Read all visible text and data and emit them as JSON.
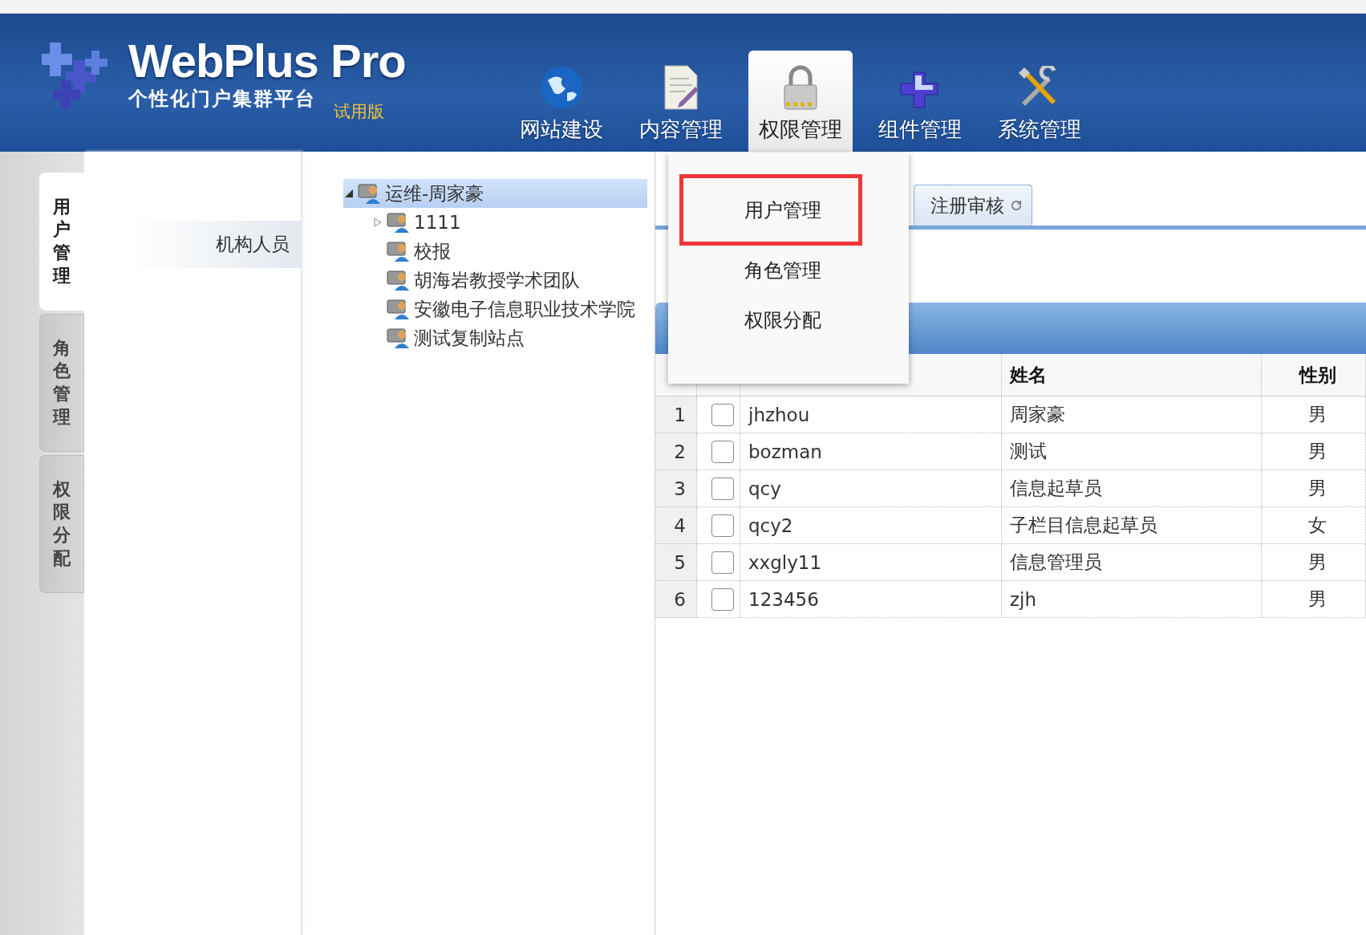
{
  "header": {
    "logo_title": "WebPlus Pro",
    "logo_subtitle": "个性化门户集群平台",
    "edition": "试用版",
    "nav": [
      {
        "label": "网站建设",
        "kind": "globe",
        "selected": false
      },
      {
        "label": "内容管理",
        "kind": "document",
        "selected": false
      },
      {
        "label": "权限管理",
        "kind": "lock",
        "selected": true
      },
      {
        "label": "组件管理",
        "kind": "puzzle",
        "selected": false
      },
      {
        "label": "系统管理",
        "kind": "tools",
        "selected": false
      }
    ]
  },
  "side_tabs": [
    {
      "label": "用户管理",
      "selected": true
    },
    {
      "label": "角色管理",
      "selected": false
    },
    {
      "label": "权限分配",
      "selected": false
    }
  ],
  "left_menu": [
    {
      "label": "机构人员",
      "selected": true
    }
  ],
  "tree": {
    "label": "运维-周家豪",
    "selected": true,
    "expanded": true,
    "children": [
      {
        "label": "1111",
        "kind": "branch",
        "selected": false
      },
      {
        "label": "校报",
        "kind": "leaf",
        "selected": false
      },
      {
        "label": "胡海岩教授学术团队",
        "kind": "leaf",
        "selected": false
      },
      {
        "label": "安徽电子信息职业技术学院",
        "kind": "leaf",
        "selected": false
      },
      {
        "label": "测试复制站点",
        "kind": "leaf",
        "selected": false
      }
    ]
  },
  "tabs": [
    {
      "label": "注册审核",
      "selected": false
    }
  ],
  "table": {
    "columns": [
      {
        "label": "姓名"
      },
      {
        "label": "性别"
      }
    ],
    "rows": [
      {
        "number": "1",
        "checked": false,
        "login": "jhzhou",
        "name": "周家豪",
        "gender": "男"
      },
      {
        "number": "2",
        "checked": false,
        "login": "bozman",
        "name": "测试",
        "gender": "男"
      },
      {
        "number": "3",
        "checked": false,
        "login": "qcy",
        "name": "信息起草员",
        "gender": "男"
      },
      {
        "number": "4",
        "checked": false,
        "login": "qcy2",
        "name": "子栏目信息起草员",
        "gender": "女"
      },
      {
        "number": "5",
        "checked": false,
        "login": "xxgly11",
        "name": "信息管理员",
        "gender": "男"
      },
      {
        "number": "6",
        "checked": false,
        "login": "123456",
        "name": "zjh",
        "gender": "男"
      }
    ]
  },
  "dropdown": {
    "items": [
      {
        "label": "用户管理",
        "highlighted": true
      },
      {
        "label": "角色管理",
        "highlighted": false
      },
      {
        "label": "权限分配",
        "highlighted": false
      }
    ]
  }
}
